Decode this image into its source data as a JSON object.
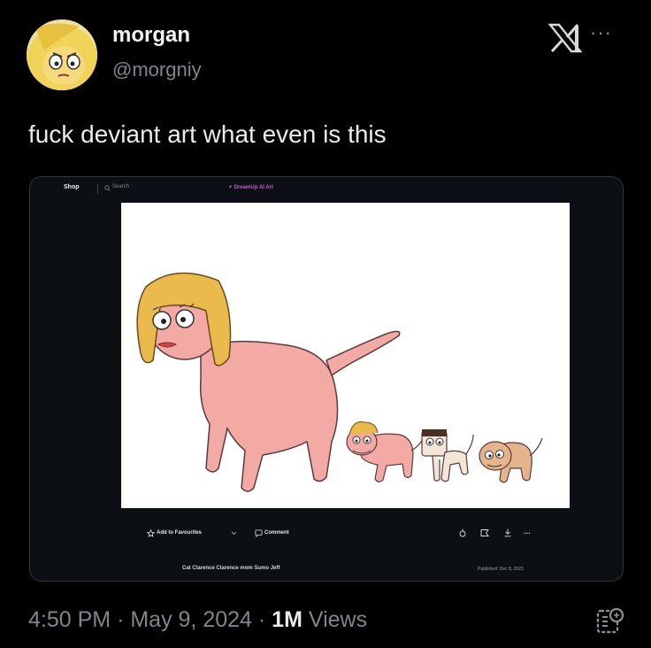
{
  "tweet": {
    "display_name": "morgan",
    "handle": "@morgniy",
    "text": "fuck deviant art what even is this",
    "time": "4:50 PM",
    "date": "May 9, 2024",
    "views_count": "1M",
    "views_label": "Views",
    "separator": "·"
  },
  "embedded_page": {
    "nav": {
      "shop": "Shop",
      "search_placeholder": "Search",
      "dreamup": "DreamUp AI Art"
    },
    "actions": {
      "add_to_favourites": "Add to Favourites",
      "comment": "Comment",
      "more": "···"
    },
    "caption": "Cat Clarence Clarence mom Sumo Jeff",
    "published": "Published: Dec 8, 2023"
  },
  "icons": {
    "header": [
      "avatar",
      "x-logo-icon",
      "more-icon"
    ],
    "actions": [
      "star-icon",
      "chevron-down-icon",
      "comment-icon",
      "share-icon",
      "flag-icon",
      "download-icon"
    ],
    "footer": [
      "grok-icon"
    ]
  },
  "colors": {
    "background": "#000000",
    "text_primary": "#e7e9ea",
    "text_secondary": "#7f8589",
    "dreamup_accent": "#c45cd1",
    "cat_body": "#f2a9a3",
    "hair": "#e8b94a"
  }
}
